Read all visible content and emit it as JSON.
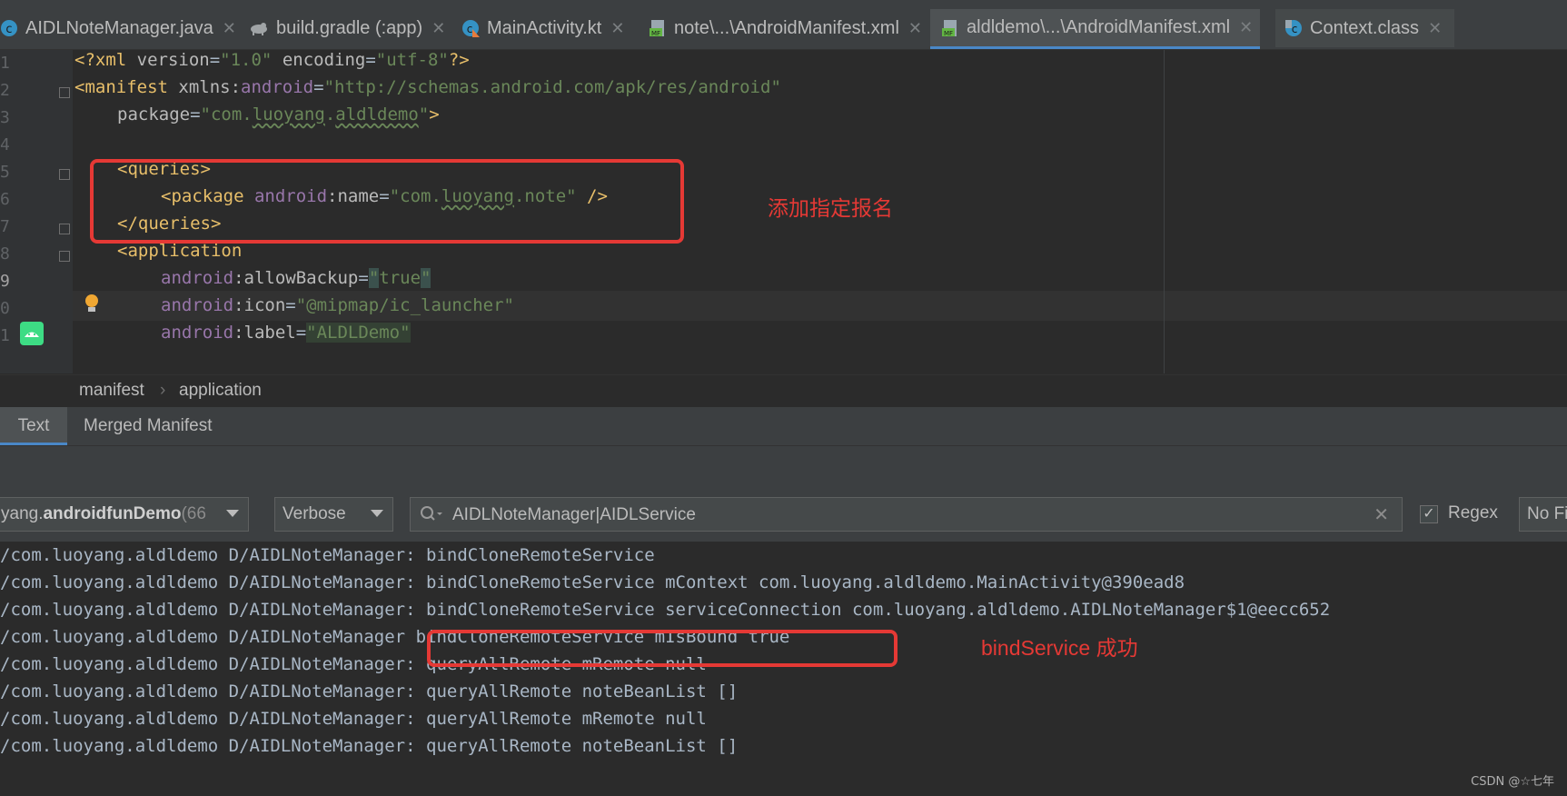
{
  "tabs": [
    {
      "label": "AIDLNoteManager.java",
      "icon": "java-class-icon",
      "active": false
    },
    {
      "label": "build.gradle (:app)",
      "icon": "gradle-icon",
      "active": false
    },
    {
      "label": "MainActivity.kt",
      "icon": "kotlin-class-icon",
      "active": false
    },
    {
      "label": "note\\...\\AndroidManifest.xml",
      "icon": "manifest-icon",
      "active": false
    },
    {
      "label": "aldldemo\\...\\AndroidManifest.xml",
      "icon": "manifest-icon",
      "active": true
    },
    {
      "label": "Context.class",
      "icon": "class-icon",
      "active": false
    }
  ],
  "editor": {
    "line_numbers": [
      "1",
      "2",
      "3",
      "4",
      "5",
      "6",
      "7",
      "8",
      "9",
      "0",
      "1"
    ],
    "lines": {
      "l1": {
        "a": "<?xml ",
        "b": "version",
        "c": "=",
        "d": "\"1.0\"",
        "e": " encoding",
        "f": "=",
        "g": "\"utf-8\"",
        "h": "?>"
      },
      "l2": {
        "a": "<manifest ",
        "b": "xmlns:",
        "c": "android",
        "d": "=",
        "e": "\"http://schemas.android.com/apk/res/android\""
      },
      "l3": {
        "a": "package",
        "b": "=",
        "c": "\"com.",
        "d": "luoyang",
        "e": ".",
        "f": "aldldemo",
        "g": "\"",
        "h": ">"
      },
      "l5": {
        "a": "<queries>"
      },
      "l6": {
        "a": "<package ",
        "b": "android",
        "c": ":name",
        "d": "=",
        "e": "\"com.",
        "f": "luoyang",
        "g": ".note\"",
        "h": " />"
      },
      "l7": {
        "a": "</queries>"
      },
      "l8": {
        "a": "<application"
      },
      "l9": {
        "a": "android",
        "b": ":allowBackup",
        "c": "=",
        "d": "\"",
        "e": "true",
        "f": "\""
      },
      "l10": {
        "a": "android",
        "b": ":icon",
        "c": "=",
        "d": "\"@mipmap/ic_launcher\""
      },
      "l11": {
        "a": "android",
        "b": ":label",
        "c": "=",
        "d": "\"ALDLDemo\""
      }
    },
    "annotation": "添加指定报名"
  },
  "breadcrumb": {
    "items": [
      "manifest",
      "application"
    ],
    "separator": "›"
  },
  "editor_tabs": [
    "Text",
    "Merged Manifest"
  ],
  "logcat": {
    "process_label": "yang.",
    "process_bold": "androidfunDemo",
    "process_suffix": " (66",
    "level": "Verbose",
    "search_value": "AIDLNoteManager|AIDLService",
    "regex_label": "Regex",
    "regex_checked": true,
    "filter_label": "No Fi",
    "lines": [
      {
        "prefix": "/com.luoyang.aldldemo D/AIDLNoteManager: ",
        "msg": "bindCloneRemoteService"
      },
      {
        "prefix": "/com.luoyang.aldldemo D/AIDLNoteManager: ",
        "msg": "bindCloneRemoteService mContext com.luoyang.aldldemo.MainActivity@390ead8"
      },
      {
        "prefix": "/com.luoyang.aldldemo D/AIDLNoteManager: ",
        "msg": "bindCloneRemoteService serviceConnection com.luoyang.aldldemo.AIDLNoteManager$1@eecc652"
      },
      {
        "prefix": "/com.luoyang.aldldemo D/AIDLNoteManager ",
        "msg": "bindCloneRemoteService mIsBound true"
      },
      {
        "prefix": "/com.luoyang.aldldemo D/AIDLNoteManager: ",
        "msg": "queryAllRemote mRemote null"
      },
      {
        "prefix": "/com.luoyang.aldldemo D/AIDLNoteManager: ",
        "msg": "queryAllRemote noteBeanList []"
      },
      {
        "prefix": "/com.luoyang.aldldemo D/AIDLNoteManager: ",
        "msg": "queryAllRemote mRemote null"
      },
      {
        "prefix": "/com.luoyang.aldldemo D/AIDLNoteManager: ",
        "msg": "queryAllRemote noteBeanList []"
      }
    ],
    "annotation": "bindService 成功"
  },
  "watermark": "CSDN @☆七年",
  "colors": {
    "accent": "#4a88c7",
    "annotation_red": "#e53935",
    "tag": "#e8bf6a",
    "string": "#6a8759",
    "namespace": "#9876aa"
  }
}
